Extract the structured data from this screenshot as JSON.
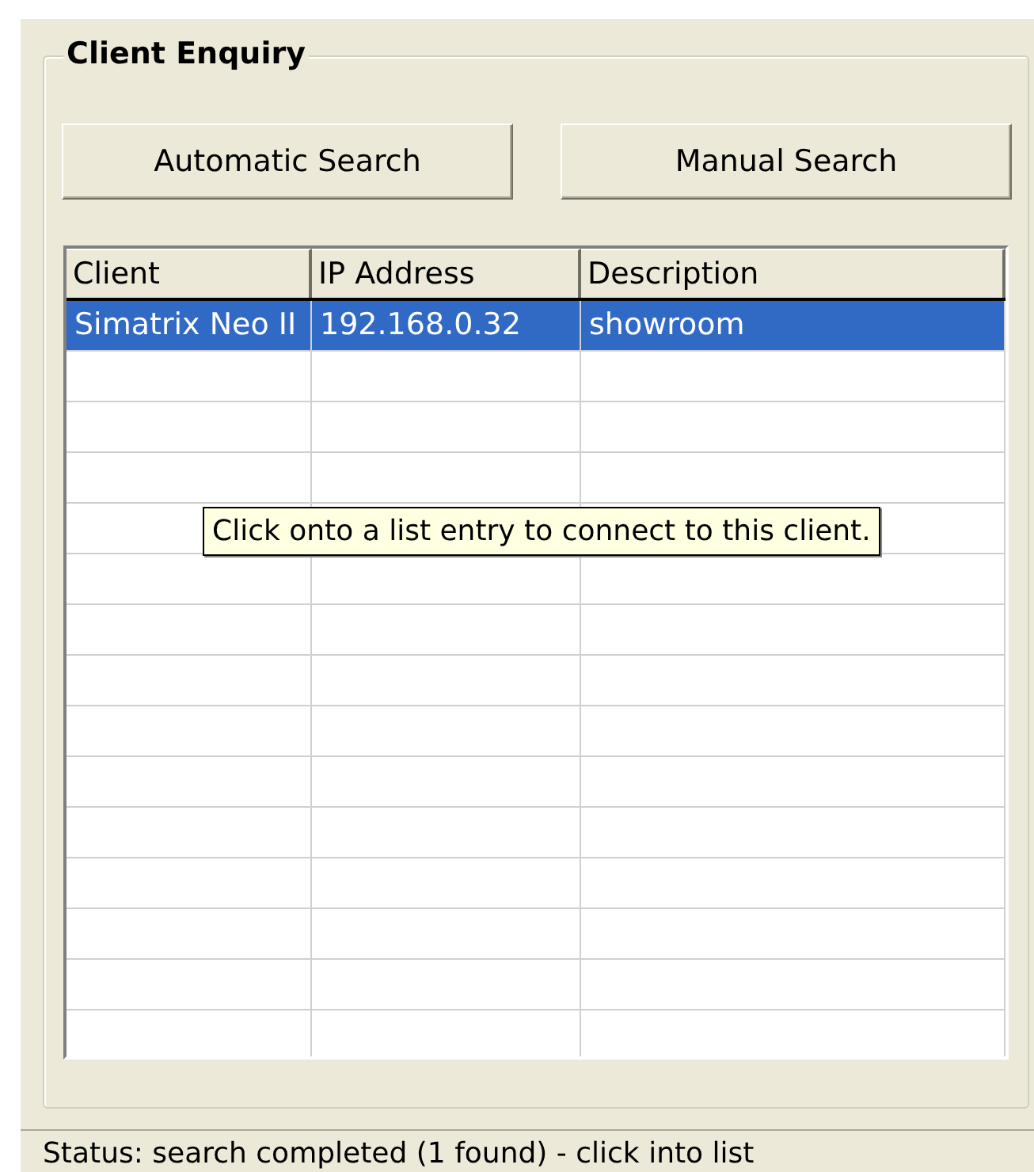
{
  "group": {
    "title": "Client Enquiry"
  },
  "buttons": [
    "Automatic Search",
    "Manual Search"
  ],
  "table": {
    "columns": [
      "Client",
      "IP Address",
      "Description"
    ],
    "rows": [
      {
        "cells": [
          "Simatrix Neo II",
          "192.168.0.32",
          "showroom"
        ],
        "selected": true
      }
    ]
  },
  "tooltip": "Click onto a list entry to connect to this client.",
  "status_bar": "Status: search completed (1 found) - click into list"
}
